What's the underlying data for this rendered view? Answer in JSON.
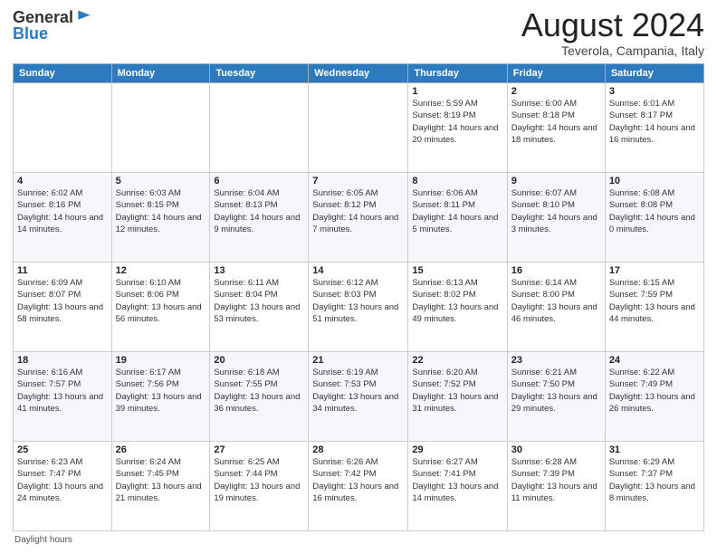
{
  "header": {
    "logo_general": "General",
    "logo_blue": "Blue",
    "month_year": "August 2024",
    "location": "Teverola, Campania, Italy"
  },
  "days_of_week": [
    "Sunday",
    "Monday",
    "Tuesday",
    "Wednesday",
    "Thursday",
    "Friday",
    "Saturday"
  ],
  "footer": {
    "daylight_hours": "Daylight hours"
  },
  "weeks": [
    [
      {
        "num": "",
        "info": ""
      },
      {
        "num": "",
        "info": ""
      },
      {
        "num": "",
        "info": ""
      },
      {
        "num": "",
        "info": ""
      },
      {
        "num": "1",
        "info": "Sunrise: 5:59 AM\nSunset: 8:19 PM\nDaylight: 14 hours and 20 minutes."
      },
      {
        "num": "2",
        "info": "Sunrise: 6:00 AM\nSunset: 8:18 PM\nDaylight: 14 hours and 18 minutes."
      },
      {
        "num": "3",
        "info": "Sunrise: 6:01 AM\nSunset: 8:17 PM\nDaylight: 14 hours and 16 minutes."
      }
    ],
    [
      {
        "num": "4",
        "info": "Sunrise: 6:02 AM\nSunset: 8:16 PM\nDaylight: 14 hours and 14 minutes."
      },
      {
        "num": "5",
        "info": "Sunrise: 6:03 AM\nSunset: 8:15 PM\nDaylight: 14 hours and 12 minutes."
      },
      {
        "num": "6",
        "info": "Sunrise: 6:04 AM\nSunset: 8:13 PM\nDaylight: 14 hours and 9 minutes."
      },
      {
        "num": "7",
        "info": "Sunrise: 6:05 AM\nSunset: 8:12 PM\nDaylight: 14 hours and 7 minutes."
      },
      {
        "num": "8",
        "info": "Sunrise: 6:06 AM\nSunset: 8:11 PM\nDaylight: 14 hours and 5 minutes."
      },
      {
        "num": "9",
        "info": "Sunrise: 6:07 AM\nSunset: 8:10 PM\nDaylight: 14 hours and 3 minutes."
      },
      {
        "num": "10",
        "info": "Sunrise: 6:08 AM\nSunset: 8:08 PM\nDaylight: 14 hours and 0 minutes."
      }
    ],
    [
      {
        "num": "11",
        "info": "Sunrise: 6:09 AM\nSunset: 8:07 PM\nDaylight: 13 hours and 58 minutes."
      },
      {
        "num": "12",
        "info": "Sunrise: 6:10 AM\nSunset: 8:06 PM\nDaylight: 13 hours and 56 minutes."
      },
      {
        "num": "13",
        "info": "Sunrise: 6:11 AM\nSunset: 8:04 PM\nDaylight: 13 hours and 53 minutes."
      },
      {
        "num": "14",
        "info": "Sunrise: 6:12 AM\nSunset: 8:03 PM\nDaylight: 13 hours and 51 minutes."
      },
      {
        "num": "15",
        "info": "Sunrise: 6:13 AM\nSunset: 8:02 PM\nDaylight: 13 hours and 49 minutes."
      },
      {
        "num": "16",
        "info": "Sunrise: 6:14 AM\nSunset: 8:00 PM\nDaylight: 13 hours and 46 minutes."
      },
      {
        "num": "17",
        "info": "Sunrise: 6:15 AM\nSunset: 7:59 PM\nDaylight: 13 hours and 44 minutes."
      }
    ],
    [
      {
        "num": "18",
        "info": "Sunrise: 6:16 AM\nSunset: 7:57 PM\nDaylight: 13 hours and 41 minutes."
      },
      {
        "num": "19",
        "info": "Sunrise: 6:17 AM\nSunset: 7:56 PM\nDaylight: 13 hours and 39 minutes."
      },
      {
        "num": "20",
        "info": "Sunrise: 6:18 AM\nSunset: 7:55 PM\nDaylight: 13 hours and 36 minutes."
      },
      {
        "num": "21",
        "info": "Sunrise: 6:19 AM\nSunset: 7:53 PM\nDaylight: 13 hours and 34 minutes."
      },
      {
        "num": "22",
        "info": "Sunrise: 6:20 AM\nSunset: 7:52 PM\nDaylight: 13 hours and 31 minutes."
      },
      {
        "num": "23",
        "info": "Sunrise: 6:21 AM\nSunset: 7:50 PM\nDaylight: 13 hours and 29 minutes."
      },
      {
        "num": "24",
        "info": "Sunrise: 6:22 AM\nSunset: 7:49 PM\nDaylight: 13 hours and 26 minutes."
      }
    ],
    [
      {
        "num": "25",
        "info": "Sunrise: 6:23 AM\nSunset: 7:47 PM\nDaylight: 13 hours and 24 minutes."
      },
      {
        "num": "26",
        "info": "Sunrise: 6:24 AM\nSunset: 7:45 PM\nDaylight: 13 hours and 21 minutes."
      },
      {
        "num": "27",
        "info": "Sunrise: 6:25 AM\nSunset: 7:44 PM\nDaylight: 13 hours and 19 minutes."
      },
      {
        "num": "28",
        "info": "Sunrise: 6:26 AM\nSunset: 7:42 PM\nDaylight: 13 hours and 16 minutes."
      },
      {
        "num": "29",
        "info": "Sunrise: 6:27 AM\nSunset: 7:41 PM\nDaylight: 13 hours and 14 minutes."
      },
      {
        "num": "30",
        "info": "Sunrise: 6:28 AM\nSunset: 7:39 PM\nDaylight: 13 hours and 11 minutes."
      },
      {
        "num": "31",
        "info": "Sunrise: 6:29 AM\nSunset: 7:37 PM\nDaylight: 13 hours and 8 minutes."
      }
    ]
  ]
}
